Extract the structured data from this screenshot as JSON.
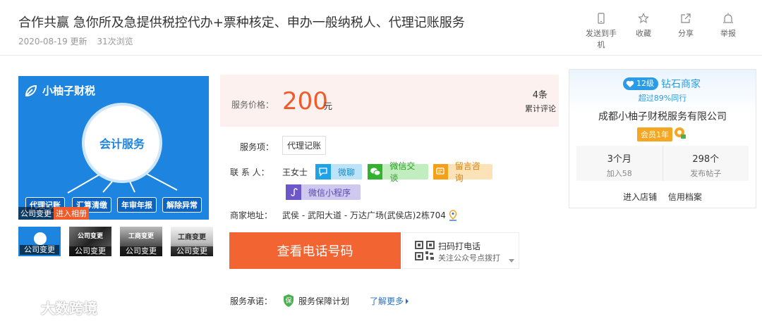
{
  "header": {
    "title": "合作共赢 急你所及急提供税控代办+票种核定、申办一般纳税人、代理记账服务",
    "date": "2020-08-19 更新",
    "views": "31次浏览",
    "actions": [
      {
        "label": "发送到手机",
        "icon": "phone-icon"
      },
      {
        "label": "收藏",
        "icon": "star-icon"
      },
      {
        "label": "分享",
        "icon": "share-icon"
      },
      {
        "label": "举报",
        "icon": "report-icon"
      }
    ]
  },
  "gallery": {
    "brand": "小柚子财税",
    "center_text": "会计服务",
    "services": [
      "代理记账",
      "汇算清缴",
      "年审年报",
      "解除异常"
    ],
    "overlay_caption": "公司变更",
    "overlay_link": "进入相册",
    "thumbs": [
      {
        "caption": "公司变更",
        "text": ""
      },
      {
        "caption": "公司变更",
        "text": "公司变更"
      },
      {
        "caption": "公司变更",
        "text": "工商变更"
      },
      {
        "caption": "公司变更",
        "text": "工商变更"
      }
    ]
  },
  "price": {
    "label": "服务价格：",
    "value": "200",
    "unit": "元",
    "review_count": "4条",
    "review_label": "累计评论"
  },
  "details": {
    "service_label": "服务项：",
    "service_item": "代理记账",
    "contact_label": "联 系 人：",
    "contact_name": "王女士",
    "chips": {
      "weiliao": "微聊",
      "wechat": "微信交谈",
      "message": "留言咨询",
      "miniprogram": "微信小程序"
    },
    "address_label": "商家地址：",
    "address": [
      "武侯",
      "武阳大道",
      "万达广场(武侯店)2栋704"
    ],
    "phone_button": "查看电话号码",
    "qr_title": "扫码打电话",
    "qr_sub": "关注公众号点拨打",
    "promise_label": "服务承诺：",
    "promise_text": "服务保障计划",
    "promise_icon_text": "保",
    "more_link": "了解更多"
  },
  "merchant": {
    "level": "12级",
    "level_name": "钻石商家",
    "rank": "超过89%同行",
    "company": "成都小柚子财税服务有限公司",
    "member": "会员1年",
    "stats": [
      {
        "value": "3个月",
        "label": "加入58"
      },
      {
        "value": "298个",
        "label": "发布帖子"
      }
    ],
    "links": [
      "进入店铺",
      "信用档案"
    ]
  },
  "watermark": "大数跨境",
  "colors": {
    "accent_orange": "#f26533",
    "price_red": "#f15a29",
    "brand_blue": "#1d85df",
    "link_blue": "#2a72c6"
  }
}
